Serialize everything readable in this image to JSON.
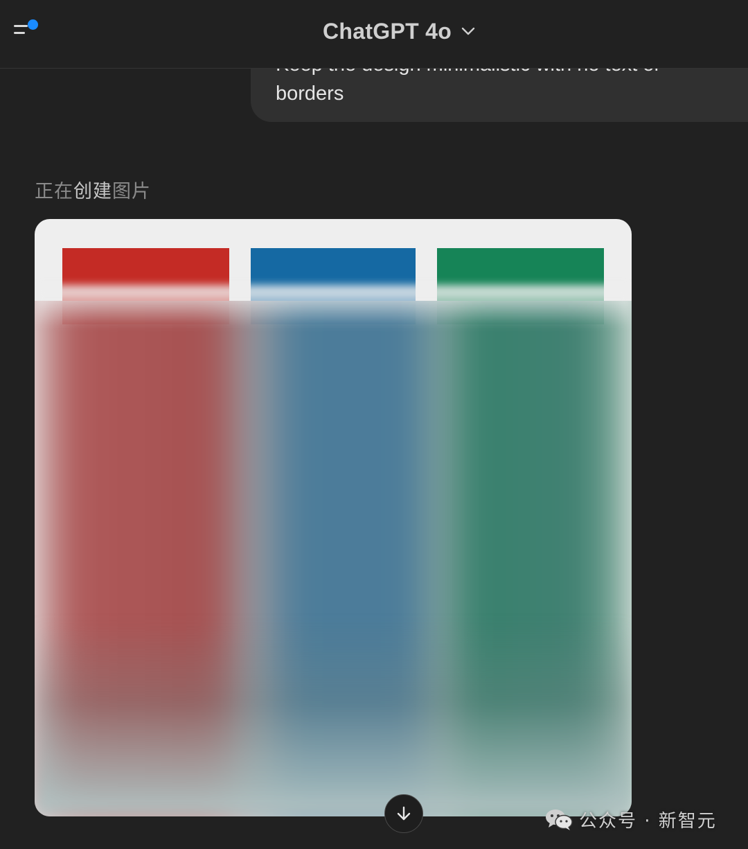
{
  "header": {
    "model_title": "ChatGPT 4o",
    "menu_icon": "sidebar-menu-icon",
    "notification_color": "#1a8bff",
    "dropdown_icon": "chevron-down-icon"
  },
  "user_message": {
    "line_partial": "Keep the design minimalistic with no text or",
    "line_last": "borders"
  },
  "assistant": {
    "status_part1": "正在",
    "status_part2": "创建",
    "status_part3": "图片",
    "generated_image": {
      "background": "#eeeeee",
      "bar_colors": [
        "#c42b25",
        "#1569a3",
        "#168457"
      ]
    }
  },
  "scroll_button_icon": "arrow-down-icon",
  "watermark": {
    "icon": "wechat-icon",
    "text": "公众号 · 新智元"
  },
  "colors": {
    "background": "#212121",
    "bubble": "#303030"
  }
}
